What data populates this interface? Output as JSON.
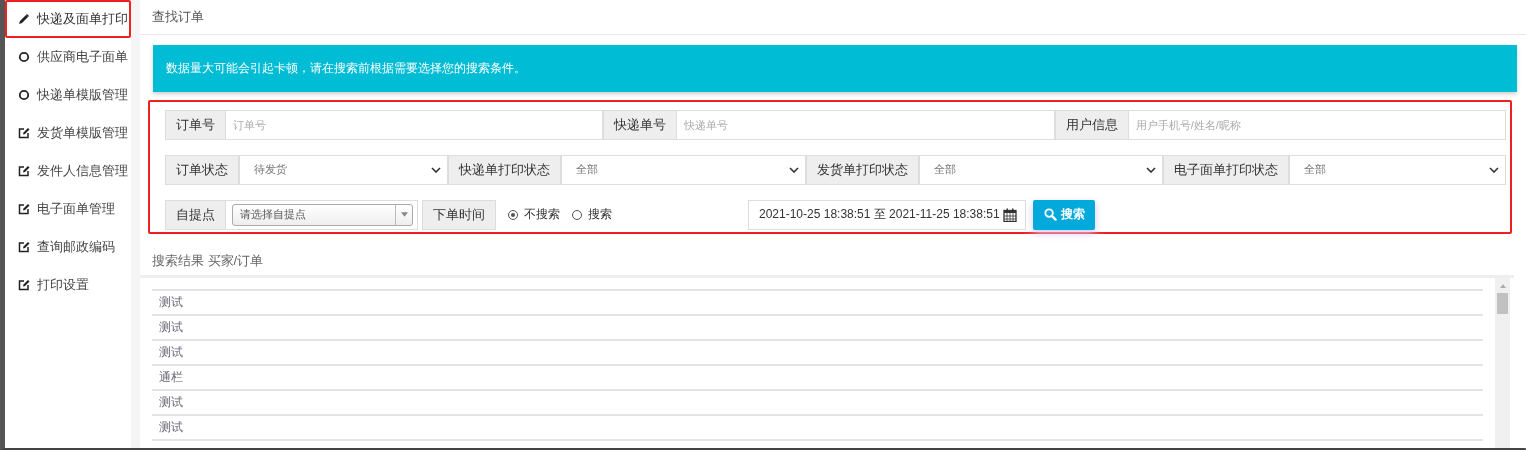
{
  "sidebar": {
    "items": [
      {
        "label": "快递及面单打印",
        "kind": "pencil",
        "selected": true
      },
      {
        "label": "供应商电子面单",
        "kind": "circle",
        "selected": false
      },
      {
        "label": "快递单模版管理",
        "kind": "circle",
        "selected": false
      },
      {
        "label": "发货单模版管理",
        "kind": "edit",
        "selected": false
      },
      {
        "label": "发件人信息管理",
        "kind": "edit",
        "selected": false
      },
      {
        "label": "电子面单管理",
        "kind": "edit",
        "selected": false
      },
      {
        "label": "查询邮政编码",
        "kind": "edit",
        "selected": false
      },
      {
        "label": "打印设置",
        "kind": "edit",
        "selected": false
      }
    ]
  },
  "panel_title": "查找订单",
  "alert": "数据量大可能会引起卡顿，请在搜索前根据需要选择您的搜索条件。",
  "filters": {
    "row_1": [
      {
        "label": "订单号",
        "placeholder": "订单号"
      },
      {
        "label": "快递单号",
        "placeholder": "快递单号"
      },
      {
        "label": "用户信息",
        "placeholder": "用户手机号/姓名/昵称"
      }
    ],
    "row_2": [
      {
        "label": "订单状态",
        "value": "待发货"
      },
      {
        "label": "快递单打印状态",
        "value": "全部"
      },
      {
        "label": "发货单打印状态",
        "value": "全部"
      },
      {
        "label": "电子面单打印状态",
        "value": "全部"
      }
    ],
    "pickup": {
      "label": "自提点",
      "placeholder": "请选择自提点"
    },
    "order_time": {
      "label": "下单时间",
      "options": [
        {
          "label": "不搜索",
          "selected": true
        },
        {
          "label": "搜索",
          "selected": false
        }
      ]
    },
    "date_range": "2021-10-25 18:38:51 至 2021-11-25 18:38:51",
    "search_button": "搜索"
  },
  "results": {
    "title": "搜索结果 买家/订单",
    "rows": [
      "测试",
      "测试",
      "测试",
      "通栏",
      "测试",
      "测试"
    ]
  }
}
